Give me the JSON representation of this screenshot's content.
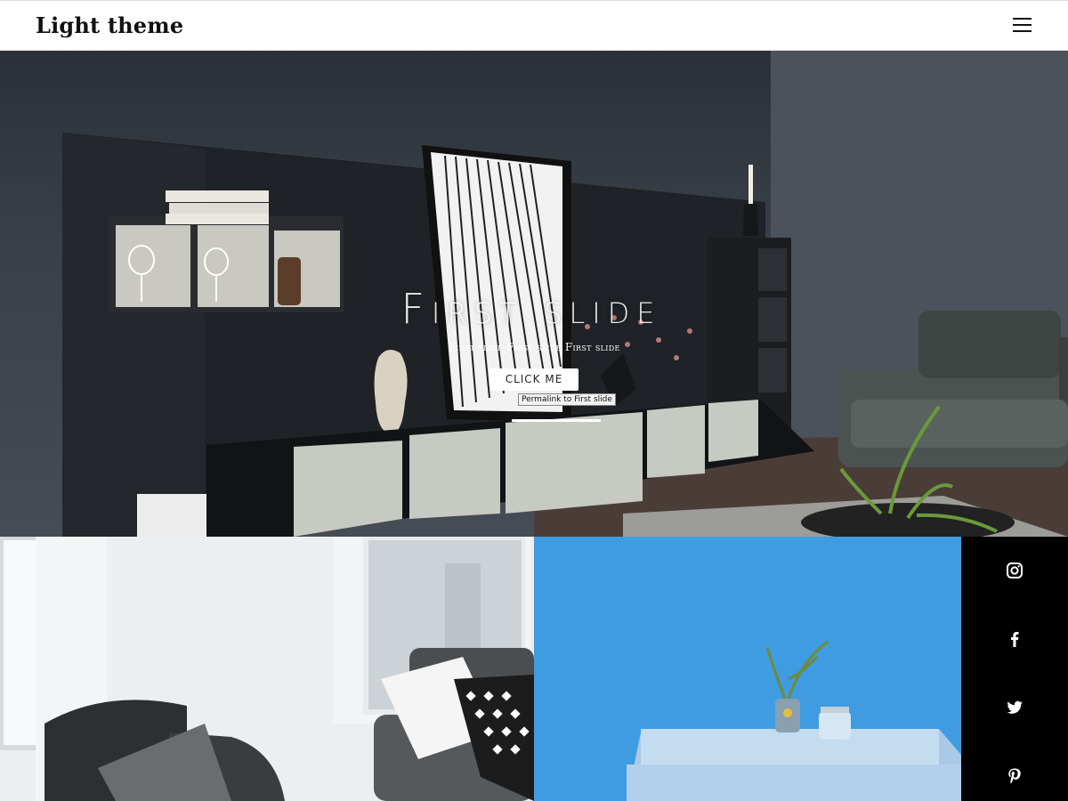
{
  "header": {
    "site_title": "Light theme",
    "menu_icon": "hamburger-menu-icon"
  },
  "hero": {
    "title": "First slide",
    "subtitle": "First slide First slide First slide",
    "button_label": "CLICK ME",
    "tooltip": "Permalink to First slide"
  },
  "gallery": {
    "items": [
      {
        "description_icon": "living-room-chairs-image"
      },
      {
        "description_icon": "blue-wall-table-image"
      }
    ]
  },
  "social": {
    "items": [
      {
        "icon": "instagram-icon"
      },
      {
        "icon": "facebook-icon"
      },
      {
        "icon": "twitter-icon"
      },
      {
        "icon": "pinterest-icon"
      }
    ]
  },
  "colors": {
    "header_bg": "#ffffff",
    "social_bg": "#000000",
    "hero_wall": "#3a4049",
    "blue_wall": "#3d9be0"
  }
}
